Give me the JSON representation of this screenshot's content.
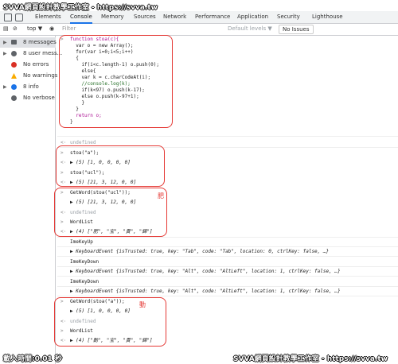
{
  "watermark": {
    "top_left": "SVVA網頁設計教學工作室 - https://svva.tw",
    "bottom_left": "載入時間:0.01 秒",
    "bottom_right": "SVVA網頁設計教學工作室 - https://svva.tw"
  },
  "tabs": [
    "Elements",
    "Console",
    "Memory",
    "Sources",
    "Network",
    "Performance",
    "Application",
    "Security",
    "Lighthouse"
  ],
  "active_tab": "Console",
  "toolbar": {
    "context": "top",
    "filter_placeholder": "Filter",
    "levels": "Default levels ▼",
    "issues": "No Issues"
  },
  "sidebar": [
    {
      "label": "8 messages",
      "icon": "list-icon",
      "color": "#5f6368"
    },
    {
      "label": "8 user mess...",
      "icon": "user-icon",
      "color": "#5f6368"
    },
    {
      "label": "No errors",
      "icon": "error-icon",
      "color": "#d93025"
    },
    {
      "label": "No warnings",
      "icon": "warning-icon",
      "color": "#f9ab00"
    },
    {
      "label": "8 info",
      "icon": "info-icon",
      "color": "#1a73e8"
    },
    {
      "label": "No verbose",
      "icon": "bug-icon",
      "color": "#5f6368"
    }
  ],
  "code_lines": [
    "function stoa(c){",
    "  var o = new Array();",
    "  for(var i=0;i<5;i++)",
    "  {",
    "    if(i<c.length-1) o.push(0);",
    "    else{",
    "    var k = c.charCodeAt(i);",
    "    //console.log(k);",
    "    if(k<97) o.push(k-17);",
    "    else o.push(k-97+1);",
    "    }",
    "  }",
    "  return o;",
    "}"
  ],
  "outputs": {
    "undefined": "undefined",
    "stoa_a": "stoa(\"a\");",
    "arr1": "(5) [1, 0, 0, 0, 0]",
    "stoa_ucl": "stoa(\"ucl\");",
    "arr2": "(5) [21, 3, 12, 0, 0]",
    "getword_ucl": "GetWord(stoa(\"ucl\"));",
    "arr3": "(5) [21, 3, 12, 0, 0]",
    "wordlist": "WordList",
    "wl1": "(4) [\"肥\", \"宝\", \"貴\", \"錦\"]",
    "imekeyup": "ImeKeyUp",
    "kb1": "KeyboardEvent {isTrusted: true, key: \"Tab\", code: \"Tab\", location: 0, ctrlKey: false, …}",
    "imekeydown": "ImeKeyDown",
    "kb2": "KeyboardEvent {isTrusted: true, key: \"Alt\", code: \"AltLeft\", location: 1, ctrlKey: false, …}",
    "kb3": "KeyboardEvent {isTrusted: true, key: \"Alt\", code: \"AltLeft\", location: 1, ctrlKey: false, …}",
    "getword_a": "GetWord(stoa(\"a\"));",
    "arr4": "(5) [1, 0, 0, 0, 0]",
    "wl2": "(4) [\"動\", \"宝\", \"貴\", \"錦\"]"
  },
  "handwriting": {
    "note1": "肥",
    "note2": "動"
  }
}
